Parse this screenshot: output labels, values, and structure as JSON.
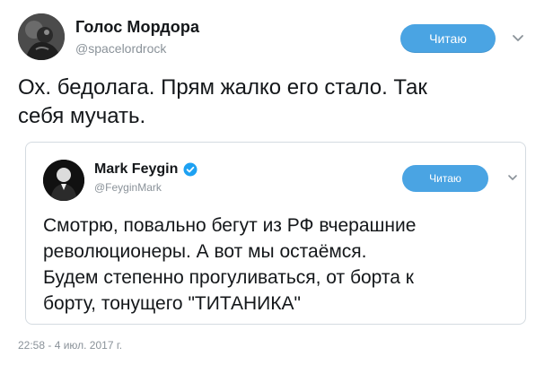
{
  "outer_tweet": {
    "author_name": "Голос Мордора",
    "author_handle": "@spacelordrock",
    "follow_label": "Читаю",
    "text": "Ох. бедолага. Прям жалко его стало. Так\nсебя мучать.",
    "avatar_icon": "user-avatar-photo",
    "more_icon": "chevron-down-icon"
  },
  "quoted_tweet": {
    "author_name": "Mark Feygin",
    "author_handle": "@FeyginMark",
    "follow_label": "Читаю",
    "verified_icon": "verified-badge-icon",
    "text": "Смотрю, повально бегут из РФ вчерашние\nреволюционеры. А вот мы остаёмся.\nБудем степенно прогуливаться, от борта к\nборту, тонущего \"ТИТАНИКА\"",
    "avatar_icon": "user-avatar-photo",
    "more_icon": "chevron-down-icon"
  },
  "timestamp": "22:58 - 4 июл. 2017 г.",
  "colors": {
    "accent": "#4aa4e3",
    "text": "#14171a",
    "muted": "#8a9299",
    "border": "#d4dbe1"
  }
}
